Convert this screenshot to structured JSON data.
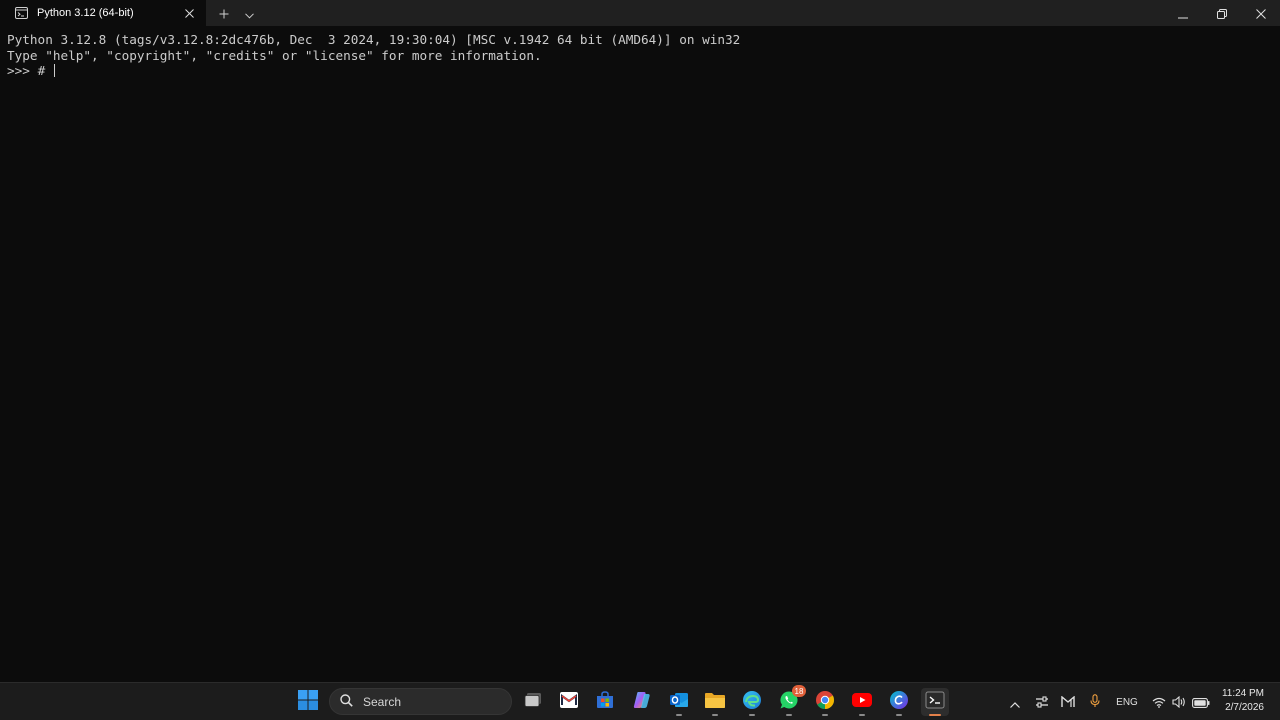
{
  "window": {
    "tab_title": "Python 3.12 (64-bit)",
    "tab_icon": "terminal-window-icon",
    "new_tab_icon": "plus-icon",
    "dropdown_icon": "chevron-down-icon",
    "controls": [
      "minimize-icon",
      "restore-icon",
      "close-icon"
    ]
  },
  "console": {
    "lines": [
      "Python 3.12.8 (tags/v3.12.8:2dc476b, Dec  3 2024, 19:30:04) [MSC v.1942 64 bit (AMD64)] on win32",
      "Type \"help\", \"copyright\", \"credits\" or \"license\" for more information."
    ],
    "prompt": ">>> ",
    "input": "# "
  },
  "taskbar": {
    "search_label": "Search",
    "whatsapp_badge": "18",
    "apps": [
      "windows-start-icon",
      "search-icon",
      "task-view-icon",
      "gmail-icon",
      "microsoft-store-icon",
      "copilot-icon",
      "outlook-icon",
      "file-explorer-icon",
      "edge-icon",
      "whatsapp-icon",
      "chrome-icon",
      "youtube-icon",
      "canva-icon",
      "terminal-icon"
    ],
    "tray": {
      "language": "ENG",
      "time": "11:24 PM",
      "date": "2/7/2026"
    }
  },
  "colors": {
    "console_bg": "#0c0c0c",
    "console_fg": "#cccccc",
    "titlebar_bg": "#202020",
    "taskbar_bg": "#1c1c1c",
    "accent": "#e3804a"
  }
}
